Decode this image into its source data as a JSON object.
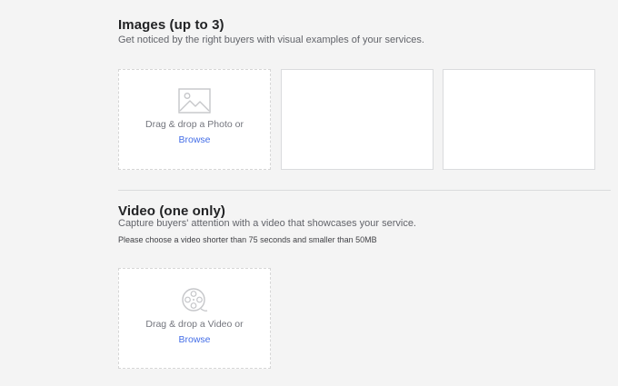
{
  "images_section": {
    "title": "Images (up to 3)",
    "subtitle": "Get noticed by the right buyers with visual examples of your services.",
    "drop_text": "Drag & drop a Photo or",
    "browse_label": "Browse",
    "photo_icon": "image-placeholder-icon"
  },
  "video_section": {
    "title": "Video (one only)",
    "subtitle": "Capture buyers' attention with a video that showcases your service.",
    "note": "Please choose a video shorter than 75 seconds and smaller than 50MB",
    "drop_text": "Drag & drop a Video or",
    "browse_label": "Browse",
    "video_icon": "film-reel-icon"
  },
  "colors": {
    "background": "#f4f4f4",
    "link": "#446ee7",
    "border": "#dadbdd"
  }
}
